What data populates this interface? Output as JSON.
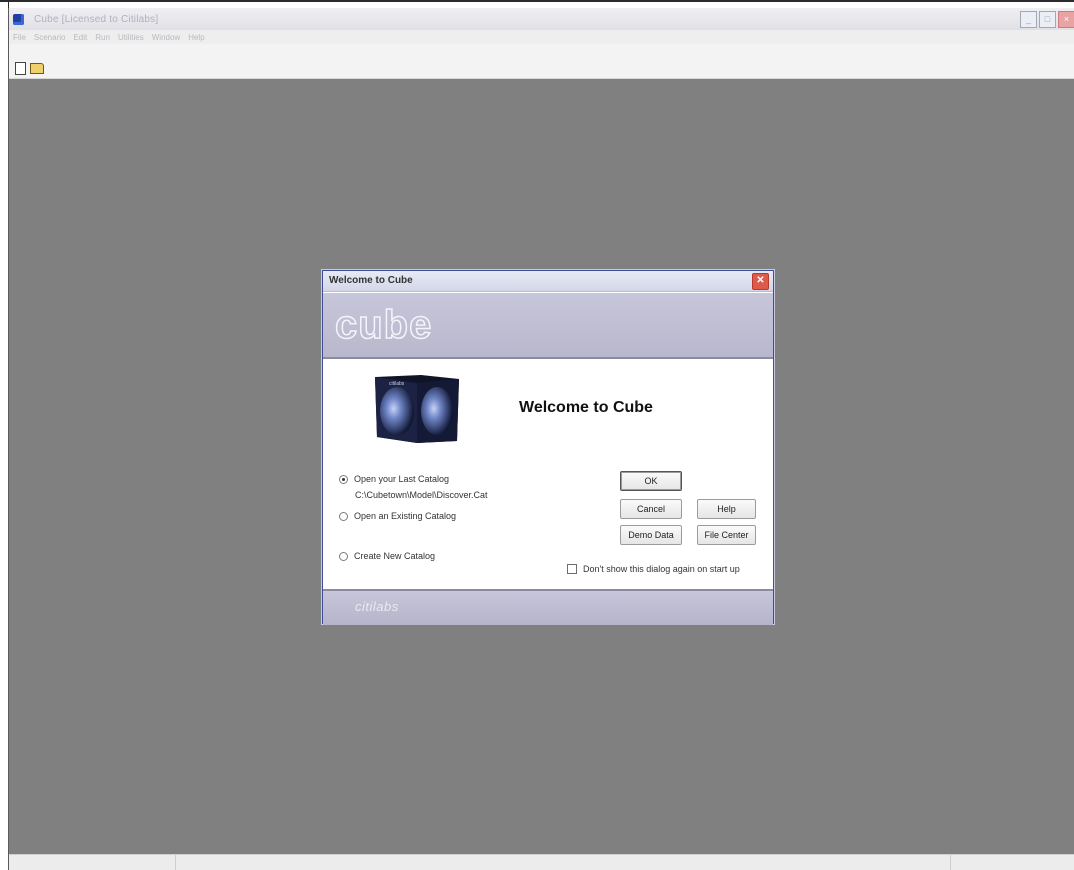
{
  "window": {
    "title": "Cube [Licensed to Citilabs]"
  },
  "menubar": {
    "items": [
      "File",
      "Scenario",
      "Edit",
      "Run",
      "Utilities",
      "Window",
      "Help"
    ]
  },
  "toolbar": {
    "icons": [
      "new-document-icon",
      "open-folder-icon"
    ]
  },
  "dialog": {
    "title": "Welcome to Cube",
    "banner_logo": "cube",
    "heading": "Welcome to Cube",
    "options": [
      {
        "label": "Open your Last Catalog",
        "selected": true
      },
      {
        "label": "Open an Existing Catalog",
        "selected": false
      },
      {
        "label": "Create New Catalog",
        "selected": false
      }
    ],
    "last_catalog_path": "C:\\Cubetown\\Model\\Discover.Cat",
    "buttons": {
      "ok": "OK",
      "cancel": "Cancel",
      "help": "Help",
      "demo_data": "Demo Data",
      "file_center": "File Center"
    },
    "checkbox": {
      "label": "Don't show this dialog again on start up",
      "checked": false
    },
    "footer_logo": "citilabs",
    "cube_image_label": "citilabs"
  },
  "colors": {
    "workspace": "#808080",
    "banner": "#c7c6da",
    "dialog_border": "#3d4f9a",
    "close_button": "#e05a4c"
  }
}
